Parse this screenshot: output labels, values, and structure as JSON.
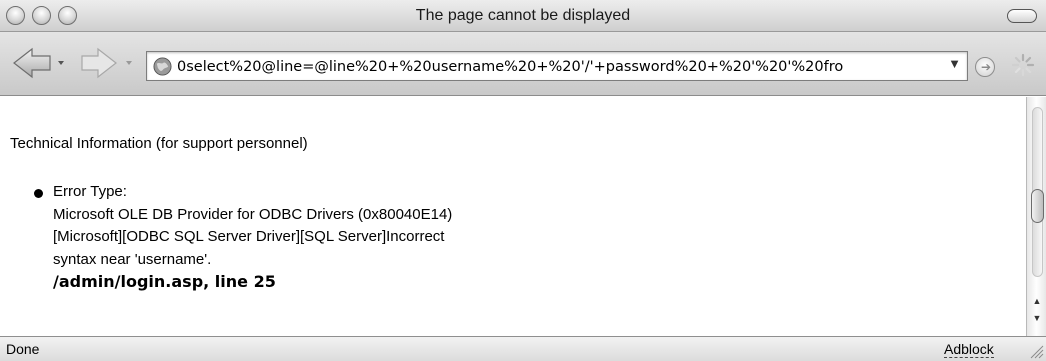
{
  "window": {
    "title": "The page cannot be displayed"
  },
  "toolbar": {
    "back_icon": "back-arrow-icon",
    "forward_icon": "forward-arrow-icon",
    "url": "0select%20@line=@line%20+%20username%20+%20'/'+password%20+%20'%20'%20fro",
    "url_dropdown": "▼",
    "go_icon": "go-icon",
    "go_glyph": "➔",
    "spinner_icon": "loading-spinner-icon"
  },
  "content": {
    "heading": "Technical Information (for support personnel)",
    "error": {
      "type_label": "Error Type:",
      "lines": [
        "Microsoft OLE DB Provider for ODBC Drivers (0x80040E14)",
        "[Microsoft][ODBC SQL Server Driver][SQL Server]Incorrect",
        "syntax near 'username'."
      ],
      "location": "/admin/login.asp, line 25"
    }
  },
  "scrollbar": {
    "up": "▲",
    "down": "▼"
  },
  "statusbar": {
    "status": "Done",
    "adblock": "Adblock"
  }
}
